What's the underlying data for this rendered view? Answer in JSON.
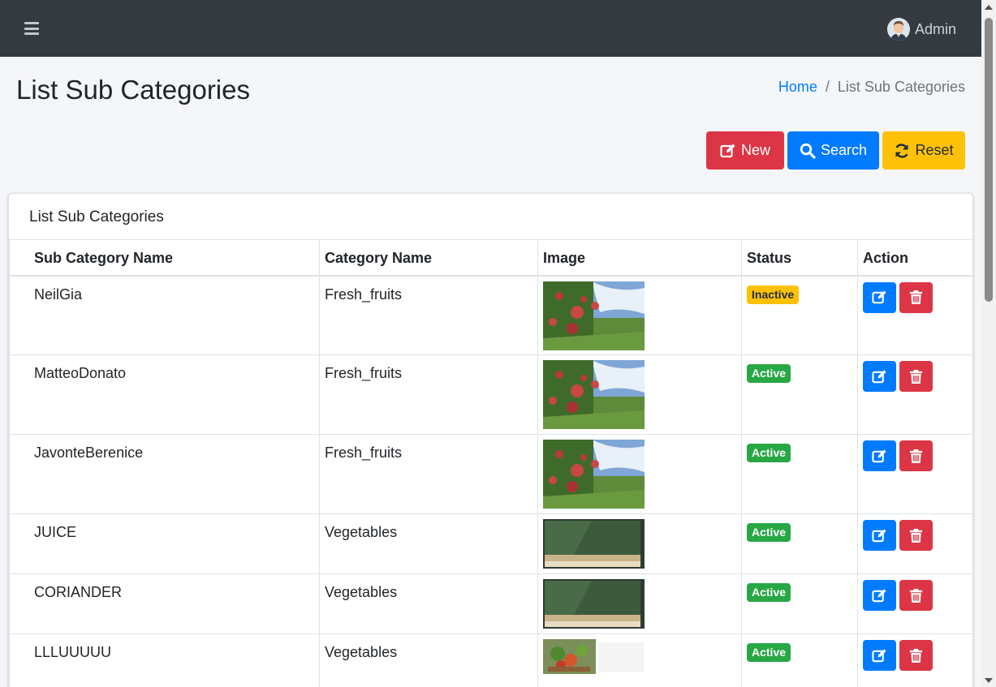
{
  "navbar": {
    "menu_icon": "bars-icon",
    "user": {
      "name": "Admin",
      "avatar_icon": "user-avatar-icon"
    }
  },
  "page": {
    "title": "List Sub Categories",
    "breadcrumb": {
      "home": "Home",
      "separator": "/",
      "current": "List Sub Categories"
    }
  },
  "actions": {
    "new_label": "New",
    "search_label": "Search",
    "reset_label": "Reset"
  },
  "card": {
    "title": "List Sub Categories",
    "columns": [
      "Sub Category Name",
      "Category Name",
      "Image",
      "Status",
      "Action"
    ],
    "rows": [
      {
        "name": "NeilGia",
        "category": "Fresh_fruits",
        "image": "apple-orchard",
        "status": "Inactive"
      },
      {
        "name": "MatteoDonato",
        "category": "Fresh_fruits",
        "image": "apple-orchard",
        "status": "Active"
      },
      {
        "name": "JavonteBerenice",
        "category": "Fresh_fruits",
        "image": "apple-orchard",
        "status": "Active"
      },
      {
        "name": "JUICE",
        "category": "Vegetables",
        "image": "green-wall-shelf",
        "status": "Active"
      },
      {
        "name": "CORIANDER",
        "category": "Vegetables",
        "image": "green-wall-shelf",
        "status": "Active"
      },
      {
        "name": "LLLUUUUU",
        "category": "Vegetables",
        "image": "vegetable-basket",
        "status": "Active"
      }
    ]
  },
  "colors": {
    "navbar": "#343a40",
    "primary": "#007bff",
    "danger": "#dc3545",
    "warning": "#ffc107",
    "success": "#28a745"
  }
}
